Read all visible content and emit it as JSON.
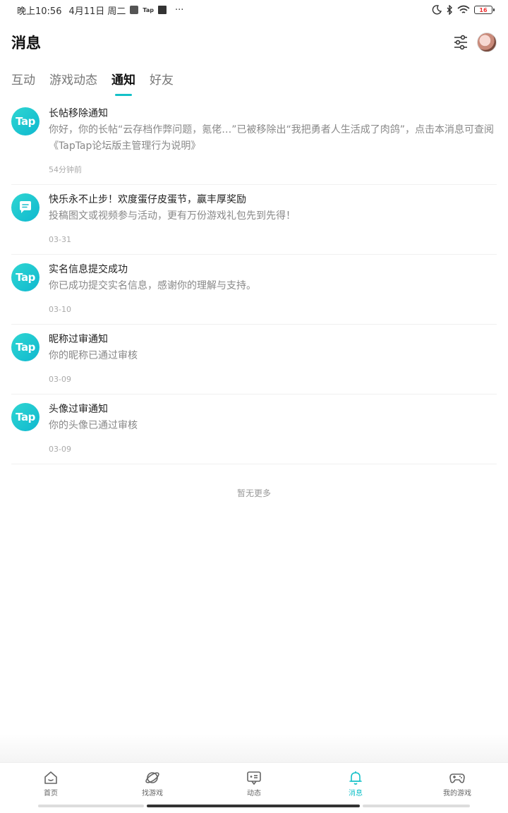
{
  "status_bar": {
    "time": "晚上10:56",
    "date": "4月11日 周二",
    "tap_label": "Tap",
    "more": "···",
    "battery": "16"
  },
  "header": {
    "title": "消息"
  },
  "tabs": [
    {
      "label": "互动",
      "active": false
    },
    {
      "label": "游戏动态",
      "active": false
    },
    {
      "label": "通知",
      "active": true
    },
    {
      "label": "好友",
      "active": false
    }
  ],
  "notifications": [
    {
      "logo": "Tap",
      "title": "长帖移除通知",
      "desc": "你好，你的长帖“云存档作弊问题，氪佬…”已被移除出“我把勇者人生活成了肉鸽”，点击本消息可查阅《TapTap论坛版主管理行为说明》",
      "time": "54分钟前"
    },
    {
      "logo": "",
      "title": "快乐永不止步！欢度蛋仔皮蛋节，赢丰厚奖励",
      "desc": "投稿图文或视频参与活动，更有万份游戏礼包先到先得！",
      "time": "03-31"
    },
    {
      "logo": "Tap",
      "title": "实名信息提交成功",
      "desc": "你已成功提交实名信息，感谢你的理解与支持。",
      "time": "03-10"
    },
    {
      "logo": "Tap",
      "title": "昵称过审通知",
      "desc": "你的昵称已通过审核",
      "time": "03-09"
    },
    {
      "logo": "Tap",
      "title": "头像过审通知",
      "desc": "你的头像已通过审核",
      "time": "03-09"
    }
  ],
  "no_more": "暂无更多",
  "bottom_nav": [
    {
      "label": "首页",
      "icon": "home-icon"
    },
    {
      "label": "找游戏",
      "icon": "planet-icon"
    },
    {
      "label": "动态",
      "icon": "feed-icon"
    },
    {
      "label": "消息",
      "icon": "bell-icon"
    },
    {
      "label": "我的游戏",
      "icon": "gamepad-icon"
    }
  ],
  "colors": {
    "accent": "#14c1c8",
    "logo_gradient_start": "#2fd6d2",
    "logo_gradient_end": "#0fb8cf"
  }
}
